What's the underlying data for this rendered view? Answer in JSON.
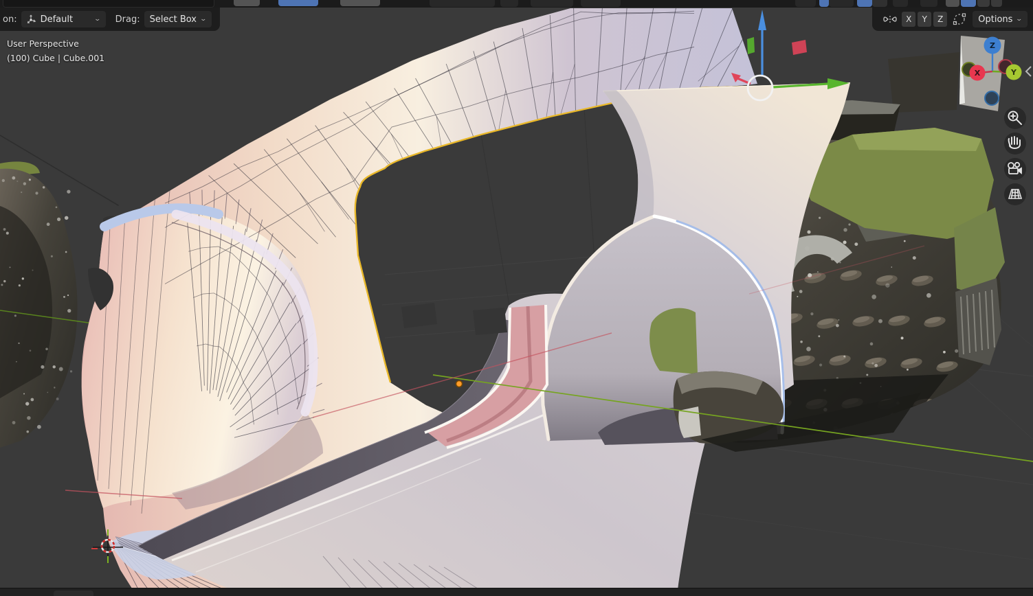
{
  "tool_header": {
    "orientation_label": "on:",
    "orientation_value": "Default",
    "drag_label": "Drag:",
    "drag_value": "Select Box",
    "mirror_x": "X",
    "mirror_y": "Y",
    "mirror_z": "Z",
    "options_label": "Options"
  },
  "viewport_overlay": {
    "view_label": "User Perspective",
    "object_label": "(100) Cube | Cube.001"
  },
  "nav_gizmo": {
    "x_label": "X",
    "y_label": "Y",
    "z_label": "Z"
  },
  "icons": [
    "transform-orientation-icon",
    "chevron-down-icon",
    "mirror-icon",
    "proportional-editing-icon",
    "zoom-icon",
    "hand-icon",
    "camera-icon",
    "grid-icon",
    "collapse-arrow-icon"
  ],
  "colors": {
    "header_bg": "#1d1d1d",
    "viewport_bg": "#3a3a3a",
    "selected_edge_yellow": "#e9b82a",
    "seam_cyan": "#38dede",
    "axis_x_red": "#c4535f",
    "axis_y_green": "#76a420",
    "gizmo_blue": "#4a8fe0",
    "gizmo_green": "#59b52e",
    "gizmo_red": "#e0455a",
    "nav_x_red": "#e8374f",
    "nav_y_green": "#a6c831",
    "nav_z_blue": "#3d7fd0",
    "origin_orange": "#ff9d2a",
    "mode_active_blue": "#4e74b4"
  }
}
